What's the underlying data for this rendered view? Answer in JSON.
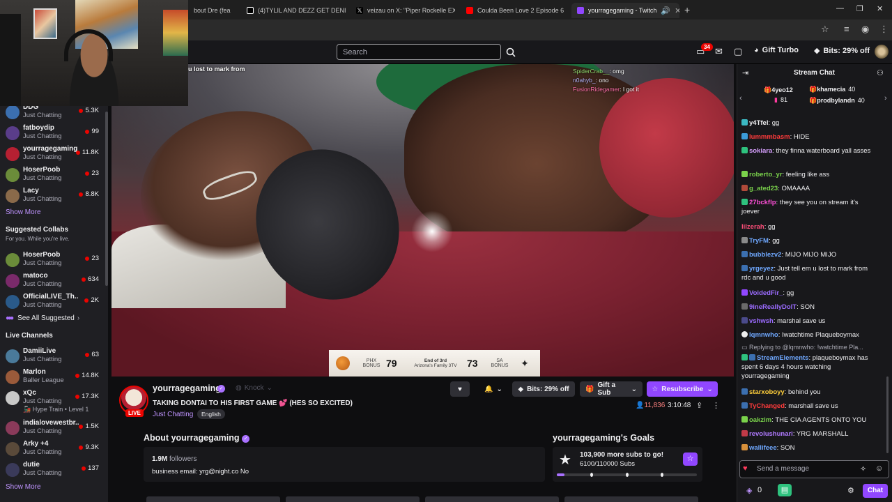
{
  "browser": {
    "tabs": [
      {
        "title": "bout Dre (fea",
        "active": false
      },
      {
        "title": "(4)TYLIL AND DEZZ GET DENIE",
        "active": false
      },
      {
        "title": "veizau on X: \"Piper Rockelle EX",
        "active": false
      },
      {
        "title": "Coulda Been Love 2 Episode 6",
        "active": false
      },
      {
        "title": "yourragegaming - Twitch",
        "active": true
      }
    ]
  },
  "topnav": {
    "search_placeholder": "Search",
    "notifications_count": "34",
    "gift_turbo": "Gift Turbo",
    "bits": "Bits: 29% off"
  },
  "sidebar": {
    "followed": [
      {
        "name": "DDG",
        "category": "Just Chatting",
        "viewers": "5.3K",
        "avatar_color": "#3b6fb0"
      },
      {
        "name": "fatboydip",
        "category": "Just Chatting",
        "viewers": "99",
        "avatar_color": "#5a3d8a"
      },
      {
        "name": "yourragegaming",
        "category": "Just Chatting",
        "viewers": "11.8K",
        "avatar_color": "#b62032"
      },
      {
        "name": "HoserPoob",
        "category": "Just Chatting",
        "viewers": "23",
        "avatar_color": "#6b8c3a"
      },
      {
        "name": "Lacy",
        "category": "Just Chatting",
        "viewers": "8.8K",
        "avatar_color": "#8a6a4a"
      }
    ],
    "show_more": "Show More",
    "suggested_collabs_title": "Suggested Collabs",
    "suggested_collabs_sub": "For you. While you're live.",
    "collabs": [
      {
        "name": "HoserPoob",
        "category": "Just Chatting",
        "viewers": "23",
        "avatar_color": "#6b8c3a"
      },
      {
        "name": "matoco",
        "category": "Just Chatting",
        "viewers": "634",
        "avatar_color": "#7a2a6a"
      },
      {
        "name": "OfficialLIVE_Th...",
        "category": "Just Chatting",
        "viewers": "2K",
        "avatar_color": "#2a5a8a"
      }
    ],
    "see_all_suggested": "See All Suggested",
    "live_channels_title": "Live Channels",
    "live": [
      {
        "name": "DamiiLive",
        "category": "Just Chatting",
        "viewers": "63",
        "avatar_color": "#4a7a9a",
        "extra": ""
      },
      {
        "name": "Marlon",
        "category": "Baller League",
        "viewers": "14.8K",
        "avatar_color": "#9a5a3a",
        "extra": ""
      },
      {
        "name": "xQc",
        "category": "Just Chatting",
        "viewers": "17.3K",
        "avatar_color": "#c8c8c8",
        "extra": "Hype Train • Level 1"
      },
      {
        "name": "indialovewestbr...",
        "category": "Just Chatting",
        "viewers": "1.5K",
        "avatar_color": "#8a3a5a",
        "extra": ""
      },
      {
        "name": "Arky +4",
        "category": "Just Chatting",
        "viewers": "9.3K",
        "avatar_color": "#5a4a3a",
        "extra": ""
      },
      {
        "name": "dutie",
        "category": "Just Chatting",
        "viewers": "137",
        "avatar_color": "#3a3a5a",
        "extra": ""
      }
    ],
    "show_more_2": "Show More"
  },
  "video": {
    "caption": "u lost to mark from",
    "overlay_chat": [
      {
        "user": "SpiderCrab__",
        "text": ": omg"
      },
      {
        "user": "n0ahyb_",
        "text": ": ono"
      },
      {
        "user": "FusionRidegamer",
        "text": ": I got it"
      }
    ],
    "scorebug": {
      "team1": "PHX",
      "score1": "79",
      "period": "End of 3rd",
      "network": "Arizona's Family 3TV",
      "team2": "SA",
      "score2": "73",
      "bonus1": "BONUS",
      "bonus2": "BONUS"
    }
  },
  "channel": {
    "name": "yourragegaming",
    "knock": "Knock",
    "title": "TAKING DONTAI TO HIS FIRST GAME 💕 (HES SO EXCITED)",
    "category": "Just Chatting",
    "tag": "English",
    "live_label": "LIVE",
    "bits_btn": "Bits: 29% off",
    "gift_sub": "Gift a Sub",
    "resubscribe": "Resubscribe",
    "viewers": "11,836",
    "uptime": "3:10:48"
  },
  "about": {
    "title": "About yourragegaming",
    "followers_count": "1.9M",
    "followers_label": "followers",
    "business_email": "business email: yrg@night.co No"
  },
  "goals": {
    "title": "yourragegaming's Goals",
    "headline": "103,900 more subs to go!",
    "progress_text": "6100/110000 Subs",
    "progress_fraction": 0.055
  },
  "chat": {
    "header": "Stream Chat",
    "gifters": [
      {
        "name": "4yeo12",
        "count": "81"
      },
      {
        "name": "khamecia",
        "count": "40"
      },
      {
        "name": "prodbylandn",
        "count": "40"
      }
    ],
    "messages": [
      {
        "user": "y4Tfel",
        "color": "#efeff1",
        "text": ": gg"
      },
      {
        "user": "lummmbasm",
        "color": "#ff3b3b",
        "text": ": HIDE"
      },
      {
        "user": "sokiara",
        "color": "#d7a0ff",
        "text": ": they finna waterboard yall asses"
      },
      {
        "user": "roberto_yr",
        "color": "#7ad24b",
        "text": ": feeling like ass"
      },
      {
        "user": "g_ated23",
        "color": "#7ad24b",
        "text": ": OMAAAA"
      },
      {
        "user": "27bckflp",
        "color": "#ff4fd8",
        "text": ": they see you on stream it's joever"
      },
      {
        "user": "lilzerah",
        "color": "#ff4f7a",
        "text": ": gg"
      },
      {
        "user": "TryFM",
        "color": "#6fa8ff",
        "text": ": gg"
      },
      {
        "user": "bubblezv2",
        "color": "#6fa8ff",
        "text": ": MIJO MIJO MIJO"
      },
      {
        "user": "yrgeyez",
        "color": "#6fa8ff",
        "text": ": Just tell em u lost to mark from rdc and u good"
      },
      {
        "user": "VoidedFir_",
        "color": "#9b6bff",
        "text": ": gg"
      },
      {
        "user": "9ineReallyDolT",
        "color": "#9b6bff",
        "text": ": SON"
      },
      {
        "user": "vshwsh",
        "color": "#9b6bff",
        "text": ": marshal save us"
      },
      {
        "user": "lqmnwho",
        "color": "#6fa8ff",
        "text": ": Iwatchtime Plaqueboymax"
      },
      {
        "user": "Replying to @lqmnwho: !watchtime Pla...",
        "color": "#adadb8",
        "text": ""
      },
      {
        "user": "StreamElements",
        "color": "#6fa8ff",
        "text": ": plaqueboymax has spent 6 days 4 hours watching yourragegaming"
      },
      {
        "user": "starxoboyy",
        "color": "#ffcf3b",
        "text": ": behind you"
      },
      {
        "user": "TyChanged",
        "color": "#ff3b3b",
        "text": ": marshall save us"
      },
      {
        "user": "oakzim",
        "color": "#7ad24b",
        "text": ": THE CIA AGENTS ONTO YOU"
      },
      {
        "user": "revolushunari",
        "color": "#b07aff",
        "text": ": YRG MARSHALL"
      },
      {
        "user": "wallifeee",
        "color": "#6fa8ff",
        "text": ": SON"
      }
    ],
    "input_placeholder": "Send a message",
    "points": "0",
    "chat_button": "Chat"
  }
}
